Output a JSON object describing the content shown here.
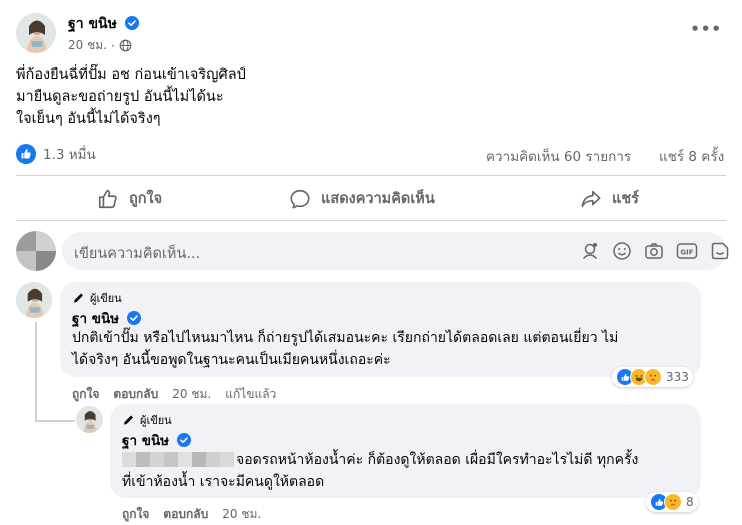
{
  "post": {
    "author": "ฐา ขนิษ",
    "time": "20 ชม.",
    "lines": [
      "พี่ก้องยืนฉี่ที่ปั๊ม อช ก่อนเข้าเจริญศิลป์",
      "มายืนดูละขอถ่ายรูป อันนี้ไม่ได้นะ",
      "ใจเย็นๆ อันนี้ไม่ได้จริงๆ"
    ],
    "reactions_count": "1.3 หมื่น",
    "comments_count": "ความคิดเห็น 60 รายการ",
    "shares_count": "แชร์ 8 ครั้ง",
    "more_label": "•••"
  },
  "actions": {
    "like": "ถูกใจ",
    "comment": "แสดงความคิดเห็น",
    "share": "แชร์"
  },
  "composer": {
    "placeholder": "เขียนความคิดเห็น..."
  },
  "comment1": {
    "tag": "ผู้เขียน",
    "author": "ฐา ขนิษ",
    "lines": [
      "ปกติเข้าปั๊ม หรือไปไหนมาไหน ก็ถ่ายรูปได้เสมอนะคะ เรียกถ่ายได้ตลอดเลย แต่ตอนเยี่ยว ไม่",
      "ได้จริงๆ อันนี้ขอพูดในฐานะคนเป็นเมียคนหนึ่งเถอะค่ะ"
    ],
    "like": "ถูกใจ",
    "reply": "ตอบกลับ",
    "time": "20 ชม.",
    "edited": "แก้ไขแล้ว",
    "reactions": "333"
  },
  "comment2": {
    "tag": "ผู้เขียน",
    "author": "ฐา ขนิษ",
    "line1": "จอดรถหน้าห้องน้ำค่ะ ก็ต้องดูให้ตลอด เผื่อมีใครทำอะไรไม่ดี ทุกครั้ง",
    "line2": "ที่เข้าห้องน้ำ เราจะมีคนดูให้ตลอด",
    "like": "ถูกใจ",
    "reply": "ตอบกลับ",
    "time": "20 ชม.",
    "reactions": "8"
  },
  "colors": {
    "brand_blue": "#1877f2",
    "secondary_text": "#65676b",
    "bubble": "#f0f2f5"
  }
}
